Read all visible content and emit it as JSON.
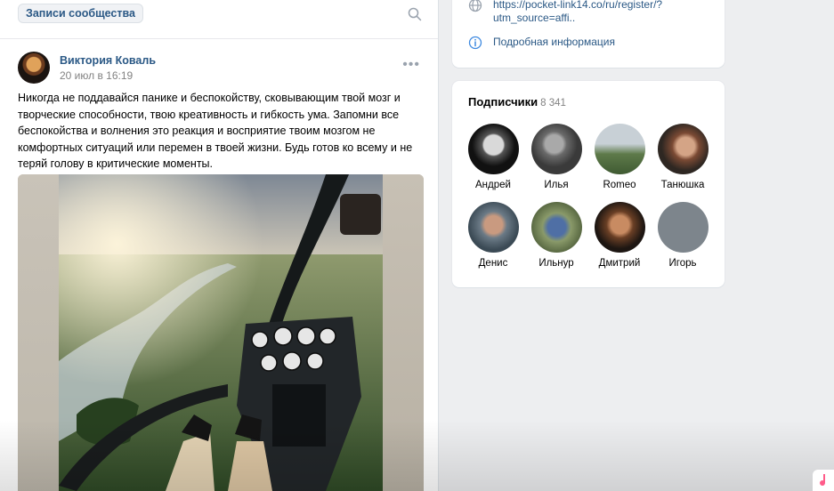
{
  "wall": {
    "tab_label": "Записи сообщества",
    "search_icon": "search-icon"
  },
  "post": {
    "author": "Виктория Коваль",
    "date": "20 июл в 16:19",
    "more_label": "•••",
    "text": "Никогда не поддавайся панике и беспокойству, сковывающим твой мозг и творческие способности, твою креативность и гибкость ума. Запомни все беспокойства и волнения это реакция и восприятие твоим мозгом не комфортных ситуаций или перемен в твоей жизни. Будь готов ко всему и не теряй голову в критические моменты."
  },
  "info": {
    "link": "https://pocket-link14.co/ru/register/?utm_source=affi..",
    "link_icon": "globe-icon",
    "more_label": "Подробная информация",
    "more_icon": "info-icon"
  },
  "subscribers": {
    "title": "Подписчики",
    "count": "8 341",
    "items": [
      {
        "name": "Андрей"
      },
      {
        "name": "Илья"
      },
      {
        "name": "Romeo"
      },
      {
        "name": "Танюшка"
      },
      {
        "name": "Денис"
      },
      {
        "name": "Ильнур"
      },
      {
        "name": "Дмитрий"
      },
      {
        "name": "Игорь"
      }
    ]
  },
  "colors": {
    "link": "#2a5885",
    "background": "#edeef0",
    "muted": "#828282"
  }
}
